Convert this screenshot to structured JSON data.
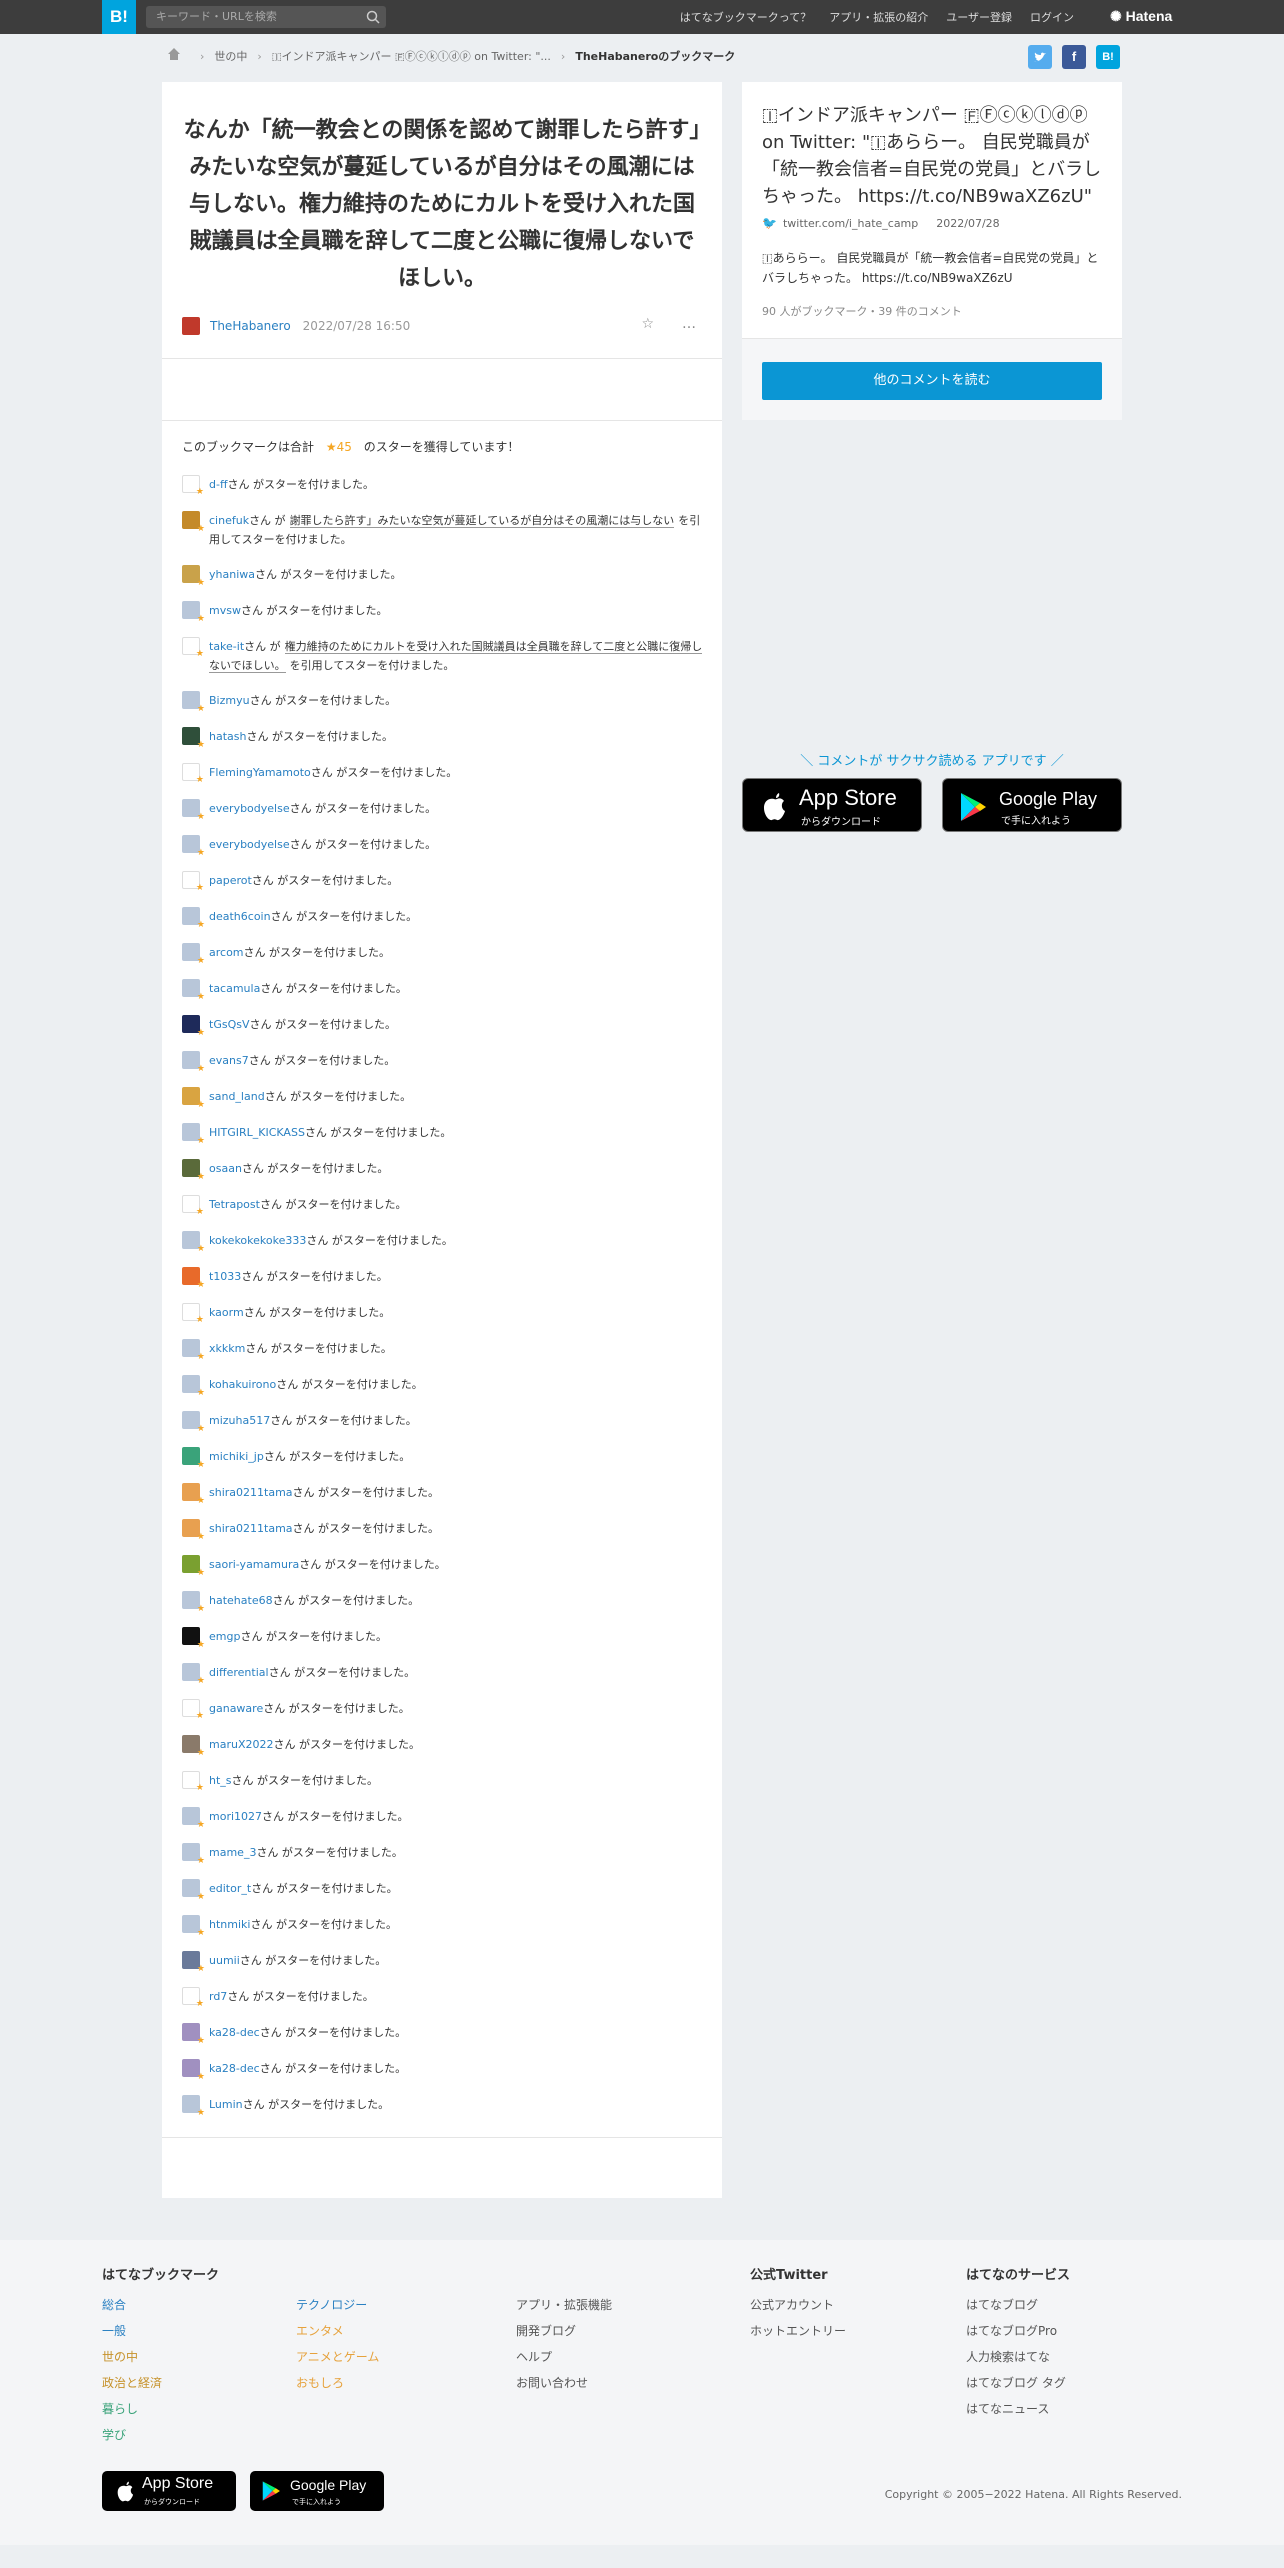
{
  "header": {
    "logo": "B!",
    "search_placeholder": "キーワード・URLを検索",
    "nav": [
      "はてなブックマークって？",
      "アプリ・拡張の紹介",
      "ユーザー登録",
      "ログイン"
    ],
    "brand": "Hatena"
  },
  "breadcrumb": {
    "items": [
      "世の中",
      "🇮インドア派キャンパー 🇫Ⓕⓒⓚⓛⓓⓟ on Twitter: \"...",
      "TheHabaneroのブックマーク"
    ]
  },
  "share": {
    "twitter": "t",
    "facebook": "f",
    "hatena": "B!"
  },
  "entry": {
    "comment": "なんか「統一教会との関係を認めて謝罪したら許す」みたいな空気が蔓延しているが自分はその風潮には与しない。権力維持のためにカルトを受け入れた国賊議員は全員職を辞して二度と公職に復帰しないでほしい。",
    "user": "TheHabanero",
    "date": "2022/07/28 16:50",
    "star_icon": "☆",
    "more_icon": "…"
  },
  "stars_summary": {
    "prefix": "このブックマークは合計",
    "count": "★45",
    "suffix": "のスターを獲得しています！"
  },
  "star_list": [
    {
      "user": "d-ff",
      "text": "さん がスターを付けました。",
      "color": "#ffffff"
    },
    {
      "user": "cinefuk",
      "text": "さん が",
      "quote": "謝罪したら許す」みたいな空気が蔓延しているが自分はその風潮には与しない",
      "after": "を引用してスターを付けました。",
      "color": "#c48a2a"
    },
    {
      "user": "yhaniwa",
      "text": "さん がスターを付けました。",
      "color": "#c9a24a"
    },
    {
      "user": "mvsw",
      "text": "さん がスターを付けました。",
      "color": "#b8c6d9"
    },
    {
      "user": "take-it",
      "text": "さん が",
      "quote": "権力維持のためにカルトを受け入れた国賊議員は全員職を辞して二度と公職に復帰しないでほしい。",
      "after": "を引用してスターを付けました。",
      "color": "#ffffff"
    },
    {
      "user": "Bizmyu",
      "text": "さん がスターを付けました。",
      "color": "#b8c6d9"
    },
    {
      "user": "hatash",
      "text": "さん がスターを付けました。",
      "color": "#2f4f3a"
    },
    {
      "user": "FlemingYamamoto",
      "text": "さん がスターを付けました。",
      "color": "#ffffff"
    },
    {
      "user": "everybodyelse",
      "text": "さん がスターを付けました。",
      "color": "#b8c6d9"
    },
    {
      "user": "everybodyelse",
      "text": "さん がスターを付けました。",
      "color": "#b8c6d9"
    },
    {
      "user": "paperot",
      "text": "さん がスターを付けました。",
      "color": "#ffffff"
    },
    {
      "user": "death6coin",
      "text": "さん がスターを付けました。",
      "color": "#b8c6d9"
    },
    {
      "user": "arcom",
      "text": "さん がスターを付けました。",
      "color": "#b8c6d9"
    },
    {
      "user": "tacamula",
      "text": "さん がスターを付けました。",
      "color": "#b8c6d9"
    },
    {
      "user": "tGsQsV",
      "text": "さん がスターを付けました。",
      "color": "#1e2a5a"
    },
    {
      "user": "evans7",
      "text": "さん がスターを付けました。",
      "color": "#b8c6d9"
    },
    {
      "user": "sand_land",
      "text": "さん がスターを付けました。",
      "color": "#d9a441"
    },
    {
      "user": "HITGIRL_KICKASS",
      "text": "さん がスターを付けました。",
      "color": "#b8c6d9"
    },
    {
      "user": "osaan",
      "text": "さん がスターを付けました。",
      "color": "#5a6a3a"
    },
    {
      "user": "Tetrapost",
      "text": "さん がスターを付けました。",
      "color": "#ffffff"
    },
    {
      "user": "kokekokekoke333",
      "text": "さん がスターを付けました。",
      "color": "#b8c6d9"
    },
    {
      "user": "t1033",
      "text": "さん がスターを付けました。",
      "color": "#e86a2a"
    },
    {
      "user": "kaorm",
      "text": "さん がスターを付けました。",
      "color": "#ffffff"
    },
    {
      "user": "xkkkm",
      "text": "さん がスターを付けました。",
      "color": "#b8c6d9"
    },
    {
      "user": "kohakuirono",
      "text": "さん がスターを付けました。",
      "color": "#b8c6d9"
    },
    {
      "user": "mizuha517",
      "text": "さん がスターを付けました。",
      "color": "#b8c6d9"
    },
    {
      "user": "michiki_jp",
      "text": "さん がスターを付けました。",
      "color": "#3aa37a"
    },
    {
      "user": "shira0211tama",
      "text": "さん がスターを付けました。",
      "color": "#e8a050"
    },
    {
      "user": "shira0211tama",
      "text": "さん がスターを付けました。",
      "color": "#e8a050"
    },
    {
      "user": "saori-yamamura",
      "text": "さん がスターを付けました。",
      "color": "#7aa030"
    },
    {
      "user": "hatehate68",
      "text": "さん がスターを付けました。",
      "color": "#b8c6d9"
    },
    {
      "user": "emgp",
      "text": "さん がスターを付けました。",
      "color": "#111111"
    },
    {
      "user": "differential",
      "text": "さん がスターを付けました。",
      "color": "#b8c6d9"
    },
    {
      "user": "ganaware",
      "text": "さん がスターを付けました。",
      "color": "#ffffff"
    },
    {
      "user": "maruX2022",
      "text": "さん がスターを付けました。",
      "color": "#8a7a6a"
    },
    {
      "user": "ht_s",
      "text": "さん がスターを付けました。",
      "color": "#ffffff"
    },
    {
      "user": "mori1027",
      "text": "さん がスターを付けました。",
      "color": "#b8c6d9"
    },
    {
      "user": "mame_3",
      "text": "さん がスターを付けました。",
      "color": "#b8c6d9"
    },
    {
      "user": "editor_t",
      "text": "さん がスターを付けました。",
      "color": "#b8c6d9"
    },
    {
      "user": "htnmiki",
      "text": "さん がスターを付けました。",
      "color": "#b8c6d9"
    },
    {
      "user": "uumii",
      "text": "さん がスターを付けました。",
      "color": "#6a7a9a"
    },
    {
      "user": "rd7",
      "text": "さん がスターを付けました。",
      "color": "#ffffff"
    },
    {
      "user": "ka28-dec",
      "text": "さん がスターを付けました。",
      "color": "#a090c0"
    },
    {
      "user": "ka28-dec",
      "text": "さん がスターを付けました。",
      "color": "#a090c0"
    },
    {
      "user": "Lumin",
      "text": "さん がスターを付けました。",
      "color": "#b8c6d9"
    }
  ],
  "sidebar": {
    "title": "🇮インドア派キャンパー 🇫Ⓕⓒⓚⓛⓓⓟ on Twitter: \"🇮あららー。 自民党職員が「統一教会信者=自民党の党員」とバラしちゃった。 https://t.co/NB9waXZ6zU\"",
    "source": "twitter.com/i_hate_camp",
    "date": "2022/07/28",
    "description": "🇮あららー。 自民党職員が「統一教会信者=自民党の党員」とバラしちゃった。 https://t.co/NB9waXZ6zU",
    "meta": "90 人がブックマーク・39 件のコメント",
    "read_button": "他のコメントを読む"
  },
  "promo": {
    "text": "＼ コメントが サクサク読める アプリです ／",
    "appstore_big": "App Store",
    "appstore_small": "からダウンロード",
    "gplay_big": "Google Play",
    "gplay_small": "で手に入れよう"
  },
  "footer": {
    "col1_title": "はてなブックマーク",
    "col1": [
      "総合",
      "一般",
      "世の中",
      "政治と経済",
      "暮らし",
      "学び"
    ],
    "col2": [
      "テクノロジー",
      "エンタメ",
      "アニメとゲーム",
      "おもしろ"
    ],
    "col3": [
      "アプリ・拡張機能",
      "開発ブログ",
      "ヘルプ",
      "お問い合わせ"
    ],
    "col4_title": "公式Twitter",
    "col4": [
      "公式アカウント",
      "ホットエントリー"
    ],
    "col5_title": "はてなのサービス",
    "col5": [
      "はてなブログ",
      "はてなブログPro",
      "人力検索はてな",
      "はてなブログ タグ",
      "はてなニュース"
    ],
    "copyright": "Copyright © 2005−2022 Hatena. All Rights Reserved.",
    "appstore_big": "App Store",
    "appstore_small": "からダウンロード",
    "gplay_big": "Google Play",
    "gplay_small": "で手に入れよう"
  }
}
